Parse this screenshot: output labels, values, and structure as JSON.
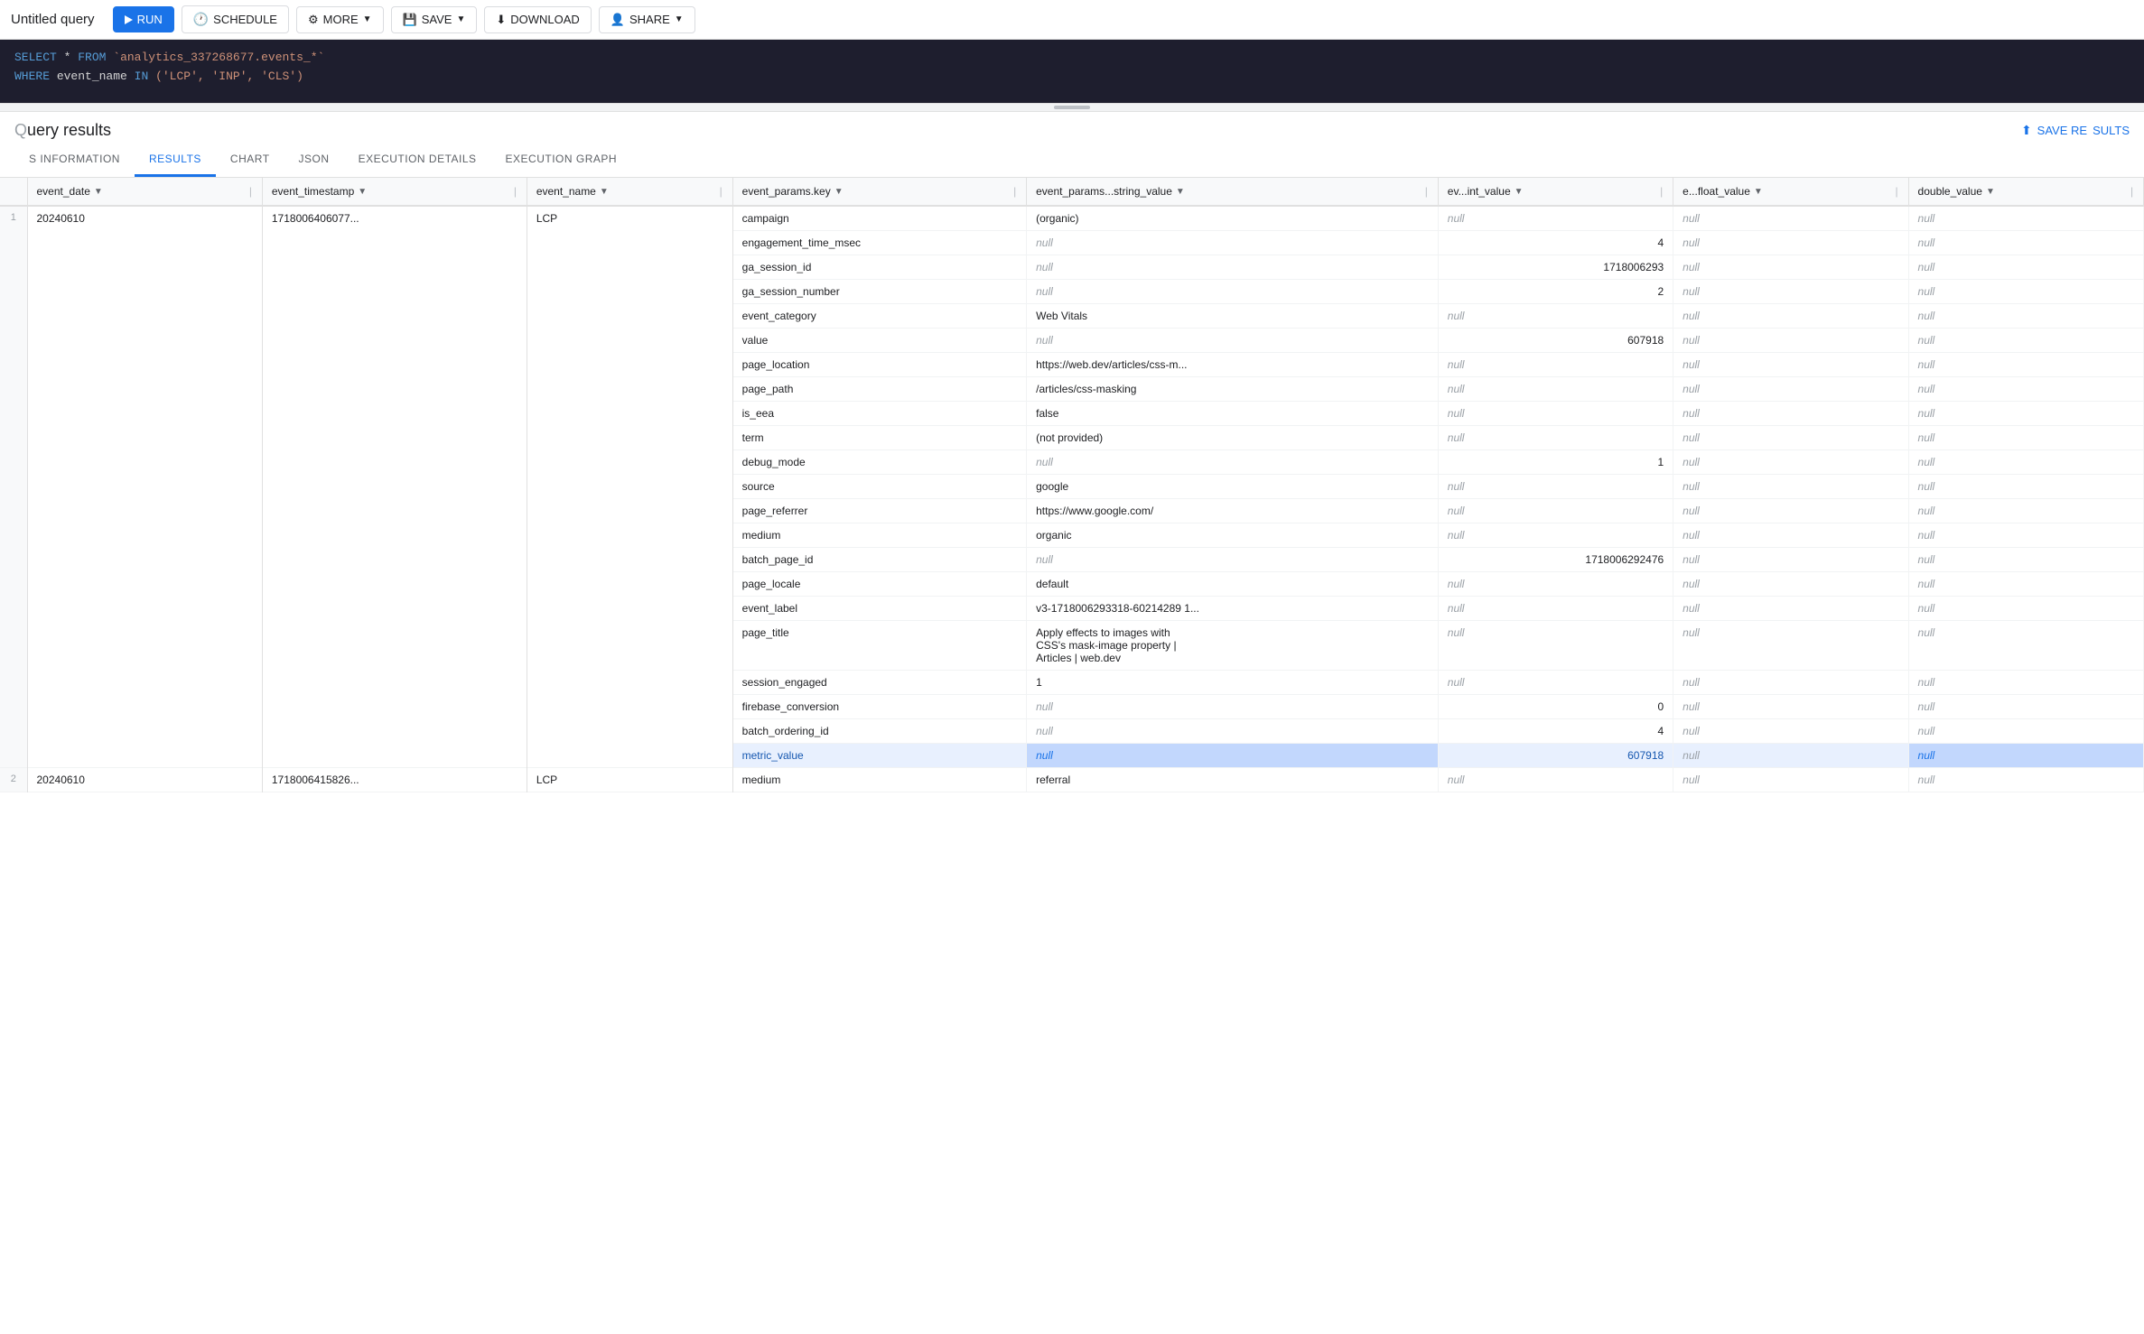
{
  "toolbar": {
    "title": "Untitled query",
    "run_label": "RUN",
    "schedule_label": "SCHEDULE",
    "more_label": "MORE",
    "save_label": "SAVE",
    "download_label": "DOWNLOAD",
    "share_label": "SHARE"
  },
  "sql": {
    "line1": "SELECT * FROM `analytics_337268677.events_*`",
    "line2": "WHERE event_name IN ('LCP', 'INP', 'CLS')"
  },
  "results": {
    "title": "uery results",
    "save_results_label": "SAVE RE",
    "tabs": [
      {
        "id": "information",
        "label": "S INFORMATION"
      },
      {
        "id": "results",
        "label": "RESULTS",
        "active": true
      },
      {
        "id": "chart",
        "label": "CHART"
      },
      {
        "id": "json",
        "label": "JSON"
      },
      {
        "id": "execution_details",
        "label": "EXECUTION DETAILS"
      },
      {
        "id": "execution_graph",
        "label": "EXECUTION GRAPH"
      }
    ],
    "columns": [
      {
        "id": "row_num",
        "label": ""
      },
      {
        "id": "event_date",
        "label": "event_date"
      },
      {
        "id": "event_timestamp",
        "label": "event_timestamp"
      },
      {
        "id": "event_name",
        "label": "event_name"
      },
      {
        "id": "event_params_key",
        "label": "event_params.key"
      },
      {
        "id": "event_params_string_value",
        "label": "event_params...string_value"
      },
      {
        "id": "event_params_int_value",
        "label": "ev...int_value"
      },
      {
        "id": "event_params_float_value",
        "label": "e...float_value"
      },
      {
        "id": "double_value",
        "label": "double_value"
      }
    ],
    "rows": [
      {
        "row_num": "1",
        "event_date": "20240610",
        "event_timestamp": "1718006406077...",
        "event_name": "LCP",
        "params": [
          {
            "key": "campaign",
            "string_value": "(organic)",
            "int_value": "null",
            "float_value": "null",
            "double_value": "null"
          },
          {
            "key": "engagement_time_msec",
            "string_value": "null",
            "int_value": "4",
            "float_value": "null",
            "double_value": "null"
          },
          {
            "key": "ga_session_id",
            "string_value": "null",
            "int_value": "1718006293",
            "float_value": "null",
            "double_value": "null"
          },
          {
            "key": "ga_session_number",
            "string_value": "null",
            "int_value": "2",
            "float_value": "null",
            "double_value": "null"
          },
          {
            "key": "event_category",
            "string_value": "Web Vitals",
            "int_value": "null",
            "float_value": "null",
            "double_value": "null"
          },
          {
            "key": "value",
            "string_value": "null",
            "int_value": "607918",
            "float_value": "null",
            "double_value": "null"
          },
          {
            "key": "page_location",
            "string_value": "https://web.dev/articles/css-m...",
            "int_value": "null",
            "float_value": "null",
            "double_value": "null"
          },
          {
            "key": "page_path",
            "string_value": "/articles/css-masking",
            "int_value": "null",
            "float_value": "null",
            "double_value": "null"
          },
          {
            "key": "is_eea",
            "string_value": "false",
            "int_value": "null",
            "float_value": "null",
            "double_value": "null"
          },
          {
            "key": "term",
            "string_value": "(not provided)",
            "int_value": "null",
            "float_value": "null",
            "double_value": "null"
          },
          {
            "key": "debug_mode",
            "string_value": "null",
            "int_value": "1",
            "float_value": "null",
            "double_value": "null"
          },
          {
            "key": "source",
            "string_value": "google",
            "int_value": "null",
            "float_value": "null",
            "double_value": "null"
          },
          {
            "key": "page_referrer",
            "string_value": "https://www.google.com/",
            "int_value": "null",
            "float_value": "null",
            "double_value": "null"
          },
          {
            "key": "medium",
            "string_value": "organic",
            "int_value": "null",
            "float_value": "null",
            "double_value": "null"
          },
          {
            "key": "batch_page_id",
            "string_value": "null",
            "int_value": "1718006292476",
            "float_value": "null",
            "double_value": "null"
          },
          {
            "key": "page_locale",
            "string_value": "default",
            "int_value": "null",
            "float_value": "null",
            "double_value": "null"
          },
          {
            "key": "event_label",
            "string_value": "v3-1718006293318-60214289 1...",
            "int_value": "null",
            "float_value": "null",
            "double_value": "null"
          },
          {
            "key": "page_title",
            "string_value": "Apply effects to images with\nCSS's mask-image property  |\nArticles  |  web.dev",
            "int_value": "null",
            "float_value": "null",
            "double_value": "null",
            "multiline": true
          },
          {
            "key": "session_engaged",
            "string_value": "1",
            "int_value": "null",
            "float_value": "null",
            "double_value": "null"
          },
          {
            "key": "firebase_conversion",
            "string_value": "null",
            "int_value": "0",
            "float_value": "null",
            "double_value": "null"
          },
          {
            "key": "batch_ordering_id",
            "string_value": "null",
            "int_value": "4",
            "float_value": "null",
            "double_value": "null"
          },
          {
            "key": "metric_value",
            "string_value": "null",
            "int_value": "607918",
            "float_value": "null",
            "double_value": "null",
            "highlight": true
          }
        ]
      },
      {
        "row_num": "2",
        "event_date": "20240610",
        "event_timestamp": "1718006415826...",
        "event_name": "LCP",
        "params": [
          {
            "key": "medium",
            "string_value": "referral",
            "int_value": "null",
            "float_value": "null",
            "double_value": "null"
          }
        ]
      }
    ]
  }
}
